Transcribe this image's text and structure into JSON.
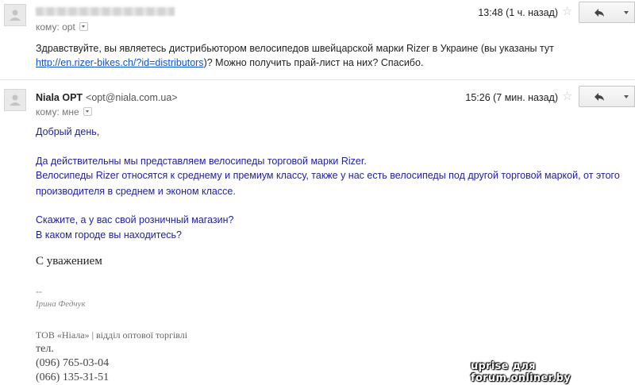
{
  "message1": {
    "to_label": "кому: opt",
    "time": "13:48 (1 ч. назад)",
    "body_text": "Здравствуйте, вы являетесь дистрибьютором велосипедов швейцарской марки Rizer в Украине (вы указаны тут ",
    "link_text": "http://en.rizer-bikes.ch/?id=distributors",
    "body_after": ")? Можно получить прай-лист на них? Спасибо."
  },
  "message2": {
    "sender_name": "Niala OPT",
    "sender_email": "<opt@niala.com.ua>",
    "to_label": "кому: мне",
    "time": "15:26 (7 мин. назад)",
    "greeting": "Добрый день,",
    "paragraph1_line1": "Да действительны мы представляем велосипеды торговой марки Rizer.",
    "paragraph1_line2": "Велосипеды Rizer относятся к среднему и премиум классу, также у нас есть велосипеды под другой торговой маркой, от этого",
    "paragraph1_line3": "производителя в среднем и эконом классе.",
    "question1": "Скажите, а у вас свой розничный магазин?",
    "question2": "В каком городе вы находитесь?",
    "signature": {
      "heading": "С уважением",
      "dashes": "--",
      "name": "Ірина Федчук",
      "company": "ТОВ «Ніала» | відділ оптової торгівлі",
      "tel_label": "тел.",
      "phone1": "(096) 765-03-04",
      "phone2": "(066) 135-31-51"
    }
  },
  "icons": {
    "star": "star-icon",
    "reply": "reply-arrow-icon",
    "more": "chevron-down-icon",
    "avatar": "default-avatar-icon"
  },
  "watermark": "uprise для forum.onliner.by",
  "colors": {
    "link": "#1155cc",
    "reply_text": "#1f1fa0"
  }
}
